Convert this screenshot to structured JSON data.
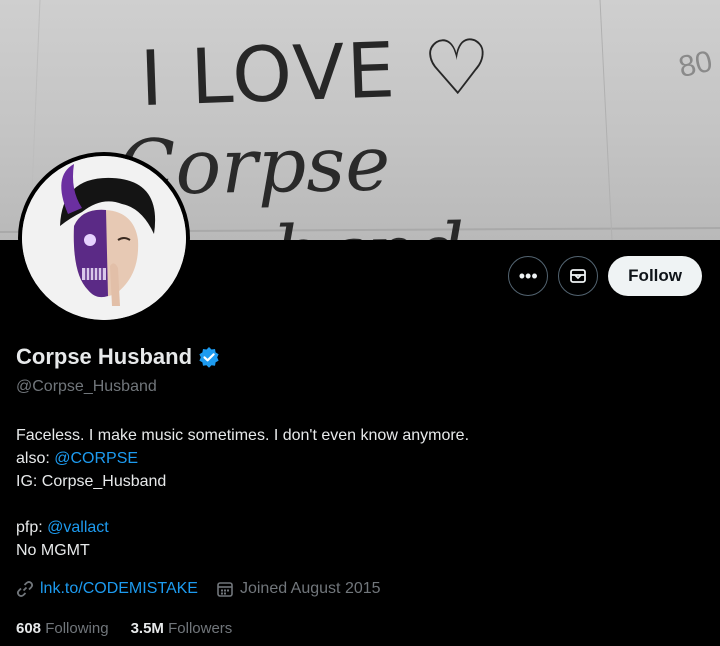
{
  "banner": {
    "graffiti_line1": "I LOVE ♡",
    "graffiti_line2": "Corpse Husband",
    "graffiti_number": "80"
  },
  "actions": {
    "more_icon": "more-horizontal-icon",
    "message_icon": "envelope-icon",
    "follow_label": "Follow"
  },
  "profile": {
    "display_name": "Corpse Husband",
    "verified_icon": "verified-badge-icon",
    "verified_color": "#1d9bf0",
    "handle": "@Corpse_Husband"
  },
  "bio": {
    "line1": "Faceless. I make music sometimes. I don't even know anymore.",
    "also_prefix": "also: ",
    "also_link": "@CORPSE",
    "ig_line": "IG: Corpse_Husband",
    "pfp_prefix": "pfp: ",
    "pfp_link": "@vallact",
    "mgmt_line": "No MGMT"
  },
  "meta": {
    "link_icon": "link-icon",
    "link_text": "lnk.to/CODEMISTAKE",
    "calendar_icon": "calendar-icon",
    "joined_text": "Joined August 2015"
  },
  "stats": {
    "following_count": "608",
    "following_label": "Following",
    "followers_count": "3.5M",
    "followers_label": "Followers"
  },
  "colors": {
    "background": "#000000",
    "text_primary": "#e7e9ea",
    "text_secondary": "#71767b",
    "link": "#1d9bf0",
    "follow_button_bg": "#eff3f4"
  }
}
